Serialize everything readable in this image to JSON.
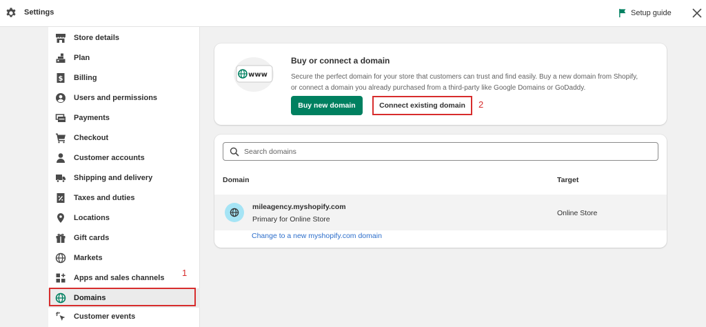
{
  "topbar": {
    "title": "Settings",
    "setup_guide": "Setup guide"
  },
  "sidebar": {
    "items": [
      {
        "label": "Store details",
        "icon": "store-icon"
      },
      {
        "label": "Plan",
        "icon": "plan-icon"
      },
      {
        "label": "Billing",
        "icon": "billing-icon"
      },
      {
        "label": "Users and permissions",
        "icon": "user-circle-icon"
      },
      {
        "label": "Payments",
        "icon": "payments-icon"
      },
      {
        "label": "Checkout",
        "icon": "cart-icon"
      },
      {
        "label": "Customer accounts",
        "icon": "person-icon"
      },
      {
        "label": "Shipping and delivery",
        "icon": "truck-icon"
      },
      {
        "label": "Taxes and duties",
        "icon": "tax-icon"
      },
      {
        "label": "Locations",
        "icon": "location-pin-icon"
      },
      {
        "label": "Gift cards",
        "icon": "gift-icon"
      },
      {
        "label": "Markets",
        "icon": "globe-icon"
      },
      {
        "label": "Apps and sales channels",
        "icon": "apps-icon"
      },
      {
        "label": "Domains",
        "icon": "domains-globe-icon",
        "active": true
      },
      {
        "label": "Customer events",
        "icon": "cursor-click-icon"
      }
    ]
  },
  "annotations": {
    "marker_1": "1",
    "marker_2": "2"
  },
  "buy_card": {
    "illustration_text": "www",
    "heading": "Buy or connect a domain",
    "description": "Secure the perfect domain for your store that customers can trust and find easily. Buy a new domain from Shopify, or connect a domain you already purchased from a third-party like Google Domains or GoDaddy.",
    "buy_button": "Buy new domain",
    "connect_button": "Connect existing domain"
  },
  "domains_card": {
    "search_placeholder": "Search domains",
    "col_domain": "Domain",
    "col_target": "Target",
    "rows": [
      {
        "domain": "mileagency.myshopify.com",
        "sub": "Primary for Online Store",
        "target": "Online Store"
      }
    ],
    "change_link": "Change to a new myshopify.com domain"
  },
  "colors": {
    "accent_green": "#008060",
    "annotation_red": "#d72c2c",
    "link_blue": "#2c6ecb",
    "badge_blue": "#a5e4f5"
  }
}
